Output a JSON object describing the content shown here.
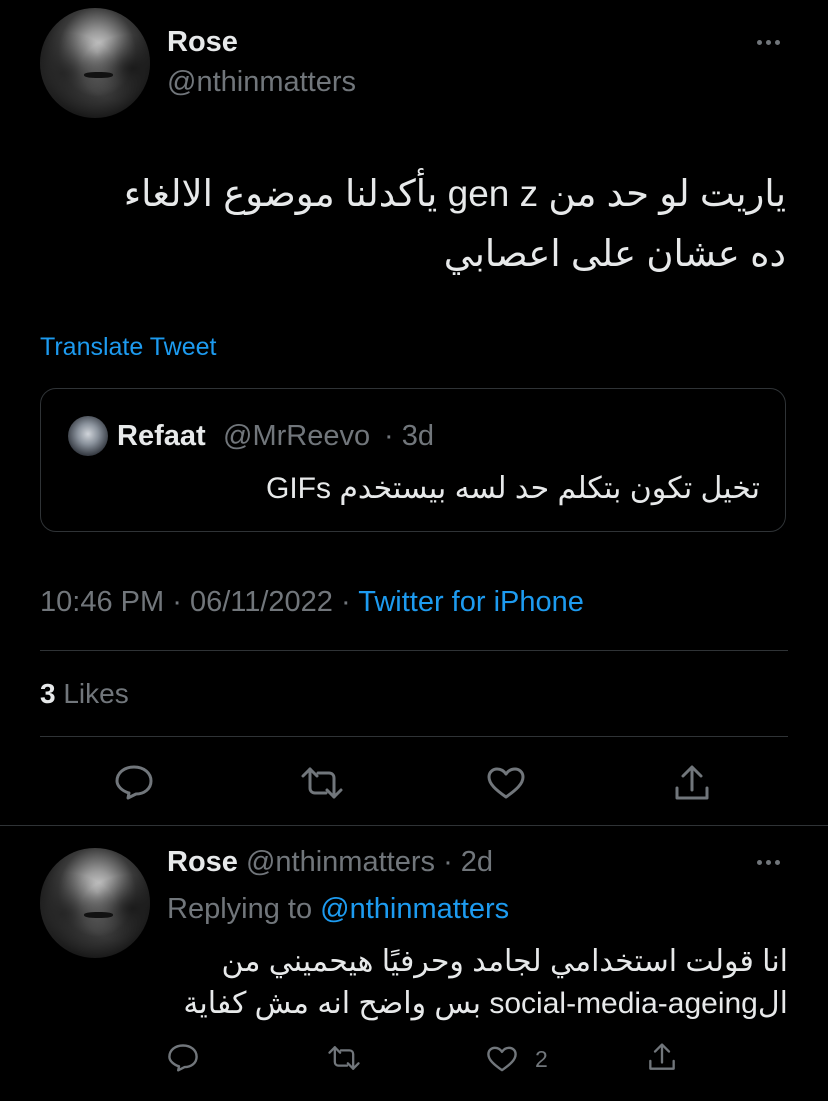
{
  "main_tweet": {
    "author_name": "Rose",
    "author_handle": "@nthinmatters",
    "text_line1": "ياريت لو حد من gen z يأكدلنا موضوع الالغاء",
    "text_line2": "ده عشان على اعصابي",
    "translate_label": "Translate Tweet",
    "quoted": {
      "author_name": "Refaat",
      "author_handle": "@MrReevo",
      "age": "· 3d",
      "text": "تخيل تكون بتكلم حد لسه بيستخدم GIFs"
    },
    "time": "10:46 PM",
    "separator1": "·",
    "date": "06/11/2022",
    "separator2": "·",
    "source": "Twitter for iPhone",
    "likes_count": "3",
    "likes_label": "Likes",
    "actions": [
      "reply-icon",
      "retweet-icon",
      "like-icon",
      "share-icon"
    ]
  },
  "reply": {
    "author_name": "Rose",
    "author_handle": "@nthinmatters",
    "age": "· 2d",
    "replying_to_label": "Replying to",
    "replying_to_handle": "@nthinmatters",
    "text_line1": "انا قولت استخدامي لجامد وحرفيًا هيحميني من",
    "text_line2": "الsocial-media-ageing بس واضح انه مش كفاية",
    "like_count": "2"
  },
  "colors": {
    "background": "#000000",
    "text": "#e7e9ea",
    "muted": "#71767b",
    "accent": "#1d9bf0",
    "border": "#2f3336"
  }
}
